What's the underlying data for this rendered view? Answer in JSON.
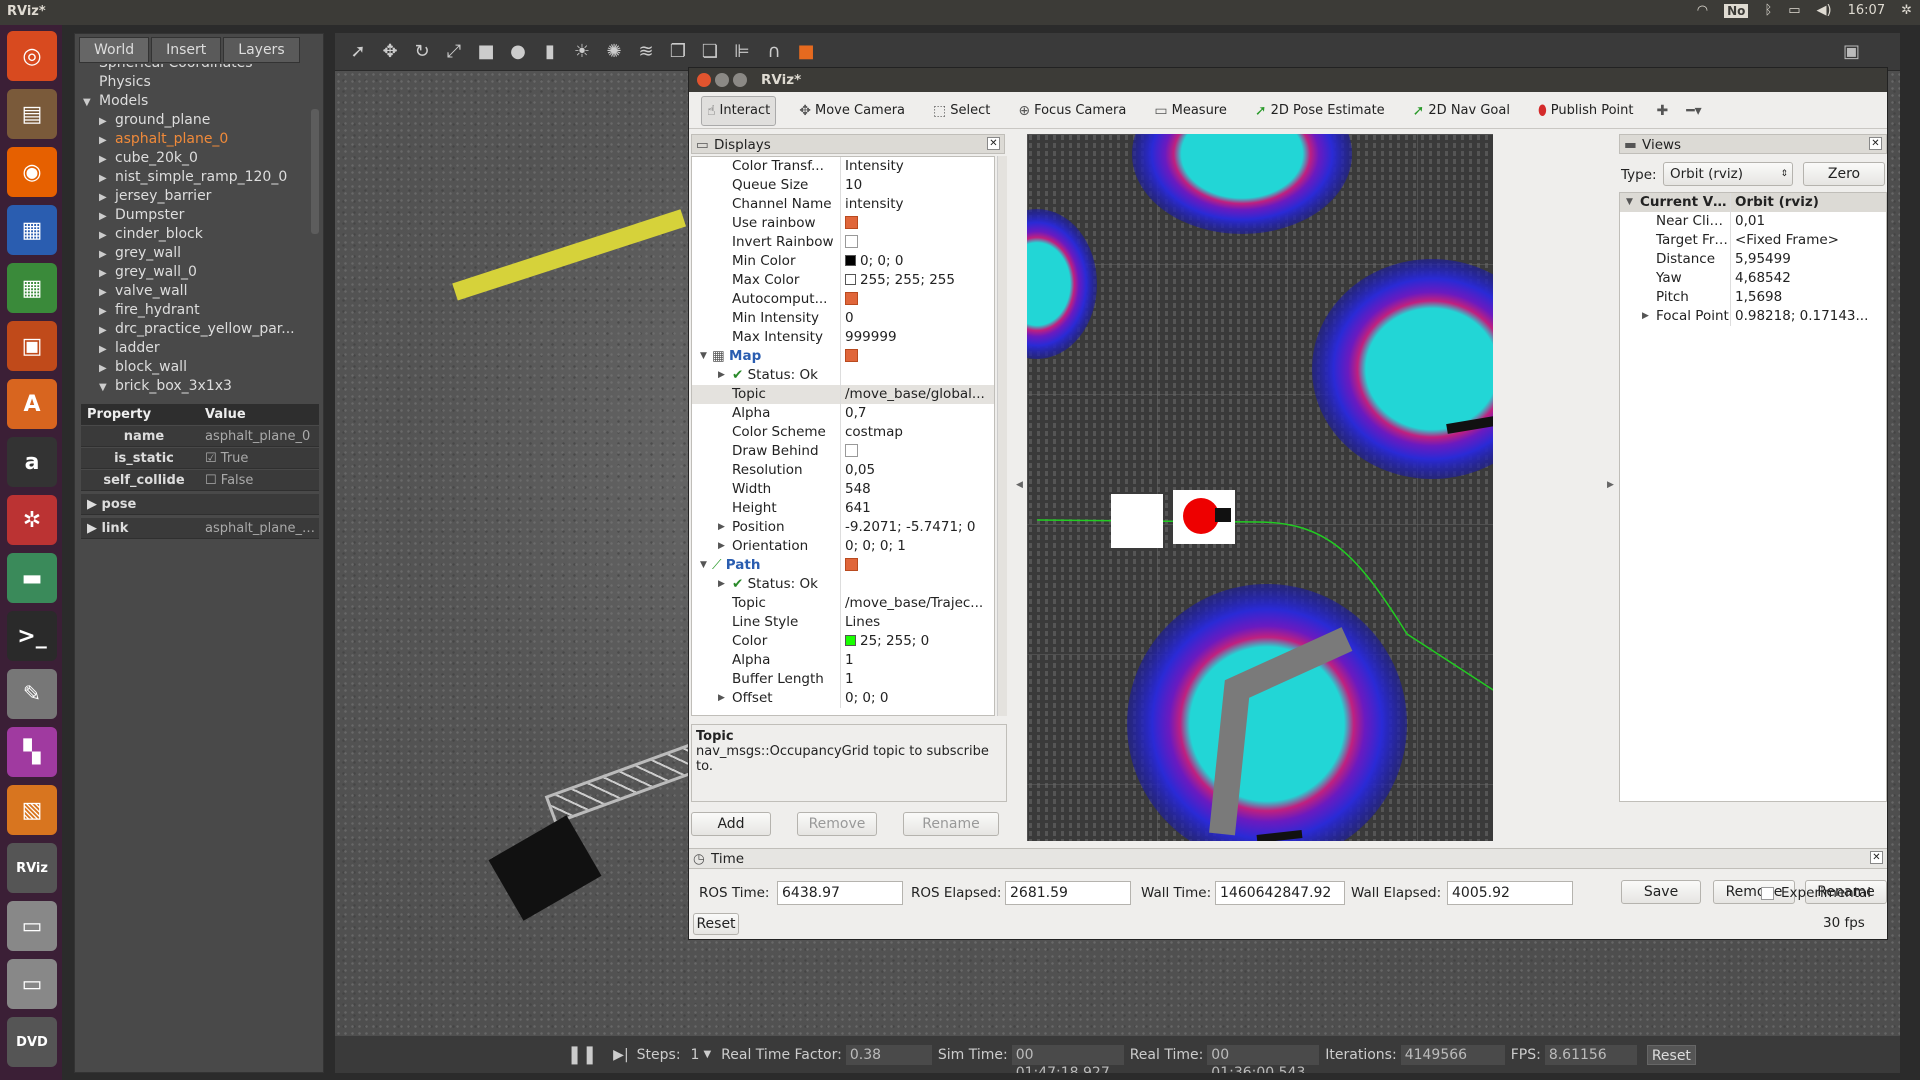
{
  "topbar": {
    "title": "RViz*",
    "keyboard": "No",
    "clock": "16:07"
  },
  "launcher": [
    {
      "name": "ubuntu-dash-icon",
      "glyph": "◎",
      "color": "#d84a1f"
    },
    {
      "name": "files-icon",
      "glyph": "▤",
      "color": "#7a5a3a"
    },
    {
      "name": "firefox-icon",
      "glyph": "◉",
      "color": "#e66000"
    },
    {
      "name": "writer-icon",
      "glyph": "▦",
      "color": "#2a5db0"
    },
    {
      "name": "calc-icon",
      "glyph": "▦",
      "color": "#3a8a3a"
    },
    {
      "name": "impress-icon",
      "glyph": "▣",
      "color": "#c04a1a"
    },
    {
      "name": "software-center-icon",
      "glyph": "A",
      "color": "#d8651f"
    },
    {
      "name": "amazon-icon",
      "glyph": "a",
      "color": "#333"
    },
    {
      "name": "settings-icon",
      "glyph": "✲",
      "color": "#b33"
    },
    {
      "name": "gazebo-icon",
      "glyph": "▬",
      "color": "#3a8a5a"
    },
    {
      "name": "terminal-icon",
      "glyph": ">_",
      "color": "#2a2a2a"
    },
    {
      "name": "text-editor-icon",
      "glyph": "✎",
      "color": "#777"
    },
    {
      "name": "workspace-icon",
      "glyph": "▚",
      "color": "#a03aa0"
    },
    {
      "name": "box-icon",
      "glyph": "▧",
      "color": "#d8751f"
    },
    {
      "name": "rviz-icon",
      "glyph": "RViz",
      "color": "#555"
    },
    {
      "name": "disk-icon",
      "glyph": "▭",
      "color": "#888"
    },
    {
      "name": "disk2-icon",
      "glyph": "▭",
      "color": "#888"
    },
    {
      "name": "dvd-icon",
      "glyph": "DVD",
      "color": "#555"
    }
  ],
  "gazebo": {
    "tabs": [
      "World",
      "Insert",
      "Layers"
    ],
    "tree": [
      {
        "label": "Spherical Coordinates",
        "indent": 0,
        "arrow": ""
      },
      {
        "label": "Physics",
        "indent": 0,
        "arrow": ""
      },
      {
        "label": "Models",
        "indent": 0,
        "arrow": "▼"
      },
      {
        "label": "ground_plane",
        "indent": 1,
        "arrow": "▶"
      },
      {
        "label": "asphalt_plane_0",
        "indent": 1,
        "arrow": "▶",
        "selected": true
      },
      {
        "label": "cube_20k_0",
        "indent": 1,
        "arrow": "▶"
      },
      {
        "label": "nist_simple_ramp_120_0",
        "indent": 1,
        "arrow": "▶"
      },
      {
        "label": "jersey_barrier",
        "indent": 1,
        "arrow": "▶"
      },
      {
        "label": "Dumpster",
        "indent": 1,
        "arrow": "▶"
      },
      {
        "label": "cinder_block",
        "indent": 1,
        "arrow": "▶"
      },
      {
        "label": "grey_wall",
        "indent": 1,
        "arrow": "▶"
      },
      {
        "label": "grey_wall_0",
        "indent": 1,
        "arrow": "▶"
      },
      {
        "label": "valve_wall",
        "indent": 1,
        "arrow": "▶"
      },
      {
        "label": "fire_hydrant",
        "indent": 1,
        "arrow": "▶"
      },
      {
        "label": "drc_practice_yellow_par...",
        "indent": 1,
        "arrow": "▶"
      },
      {
        "label": "ladder",
        "indent": 1,
        "arrow": "▶"
      },
      {
        "label": "block_wall",
        "indent": 1,
        "arrow": "▶"
      },
      {
        "label": "brick_box_3x1x3",
        "indent": 1,
        "arrow": "▼"
      }
    ],
    "props_header": {
      "k": "Property",
      "v": "Value"
    },
    "props": [
      {
        "k": "name",
        "v": "asphalt_plane_0"
      },
      {
        "k": "is_static",
        "v": "True",
        "check": true
      },
      {
        "k": "self_collide",
        "v": "False",
        "check": false
      }
    ],
    "groups": [
      {
        "k": "pose",
        "v": ""
      },
      {
        "k": "link",
        "v": "asphalt_plane_0..."
      }
    ],
    "status": {
      "steps_label": "Steps:",
      "steps": "1",
      "rtf_label": "Real Time Factor:",
      "rtf": "0.38",
      "sim_label": "Sim Time:",
      "sim": "00 01:47:18.927",
      "real_label": "Real Time:",
      "real": "00 01:36:00.543",
      "iter_label": "Iterations:",
      "iter": "4149566",
      "fps_label": "FPS:",
      "fps": "8.61156",
      "reset": "Reset"
    }
  },
  "rviz": {
    "title": "RViz*",
    "toolbar": [
      "Interact",
      "Move Camera",
      "Select",
      "Focus Camera",
      "Measure",
      "2D Pose Estimate",
      "2D Nav Goal",
      "Publish Point"
    ],
    "displays_title": "Displays",
    "rows": [
      {
        "k": "Color Transf...",
        "v": "Intensity",
        "ind": 1
      },
      {
        "k": "Queue Size",
        "v": "10",
        "ind": 1
      },
      {
        "k": "Channel Name",
        "v": "intensity",
        "ind": 1
      },
      {
        "k": "Use rainbow",
        "v": "",
        "cb": "on",
        "ind": 1
      },
      {
        "k": "Invert Rainbow",
        "v": "",
        "cb": "off",
        "ind": 1
      },
      {
        "k": "Min Color",
        "v": "0; 0; 0",
        "sw": "#000000",
        "ind": 1
      },
      {
        "k": "Max Color",
        "v": "255; 255; 255",
        "sw": "#ffffff",
        "ind": 1
      },
      {
        "k": "Autocomput...",
        "v": "",
        "cb": "on",
        "ind": 1
      },
      {
        "k": "Min Intensity",
        "v": "0",
        "ind": 1
      },
      {
        "k": "Max Intensity",
        "v": "999999",
        "ind": 1
      },
      {
        "k": "Map",
        "v": "",
        "cb": "on",
        "ind": 0,
        "blue": true,
        "arrow": "▼"
      },
      {
        "k": "Status: Ok",
        "v": "",
        "ind": 1,
        "arrow": "▶",
        "ok": true
      },
      {
        "k": "Topic",
        "v": "/move_base/global...",
        "ind": 1,
        "sel": true
      },
      {
        "k": "Alpha",
        "v": "0,7",
        "ind": 1
      },
      {
        "k": "Color Scheme",
        "v": "costmap",
        "ind": 1
      },
      {
        "k": "Draw Behind",
        "v": "",
        "cb": "off",
        "ind": 1
      },
      {
        "k": "Resolution",
        "v": "0,05",
        "ind": 1
      },
      {
        "k": "Width",
        "v": "548",
        "ind": 1
      },
      {
        "k": "Height",
        "v": "641",
        "ind": 1
      },
      {
        "k": "Position",
        "v": "-9.2071; -5.7471; 0",
        "ind": 1,
        "arrow": "▶"
      },
      {
        "k": "Orientation",
        "v": "0; 0; 0; 1",
        "ind": 1,
        "arrow": "▶"
      },
      {
        "k": "Path",
        "v": "",
        "cb": "on",
        "ind": 0,
        "blue": true,
        "arrow": "▼"
      },
      {
        "k": "Status: Ok",
        "v": "",
        "ind": 1,
        "arrow": "▶",
        "ok": true
      },
      {
        "k": "Topic",
        "v": "/move_base/Trajec...",
        "ind": 1
      },
      {
        "k": "Line Style",
        "v": "Lines",
        "ind": 1
      },
      {
        "k": "Color",
        "v": "25; 255; 0",
        "sw": "#19ff00",
        "ind": 1
      },
      {
        "k": "Alpha",
        "v": "1",
        "ind": 1
      },
      {
        "k": "Buffer Length",
        "v": "1",
        "ind": 1
      },
      {
        "k": "Offset",
        "v": "0; 0; 0",
        "ind": 1,
        "arrow": "▶"
      }
    ],
    "help": {
      "title": "Topic",
      "text": "nav_msgs::OccupancyGrid topic to subscribe to."
    },
    "buttons": {
      "add": "Add",
      "remove": "Remove",
      "rename": "Rename"
    },
    "views": {
      "title": "Views",
      "type_label": "Type:",
      "type_value": "Orbit (rviz)",
      "zero": "Zero",
      "rows": [
        {
          "k": "Current View",
          "v": "Orbit (rviz)",
          "head": true
        },
        {
          "k": "Near Clip ...",
          "v": "0,01"
        },
        {
          "k": "Target Fra...",
          "v": "<Fixed Frame>"
        },
        {
          "k": "Distance",
          "v": "5,95499"
        },
        {
          "k": "Yaw",
          "v": "4,68542"
        },
        {
          "k": "Pitch",
          "v": "1,5698"
        },
        {
          "k": "Focal Point",
          "v": "0.98218; 0.17143...",
          "arrow": "▶"
        }
      ],
      "save": "Save",
      "remove": "Remove",
      "rename": "Rename"
    },
    "time": {
      "title": "Time",
      "ros_time_label": "ROS Time:",
      "ros_time": "6438.97",
      "ros_elapsed_label": "ROS Elapsed:",
      "ros_elapsed": "2681.59",
      "wall_time_label": "Wall Time:",
      "wall_time": "1460642847.92",
      "wall_elapsed_label": "Wall Elapsed:",
      "wall_elapsed": "4005.92",
      "experimental": "Experimental",
      "reset": "Reset",
      "fps": "30 fps"
    }
  }
}
